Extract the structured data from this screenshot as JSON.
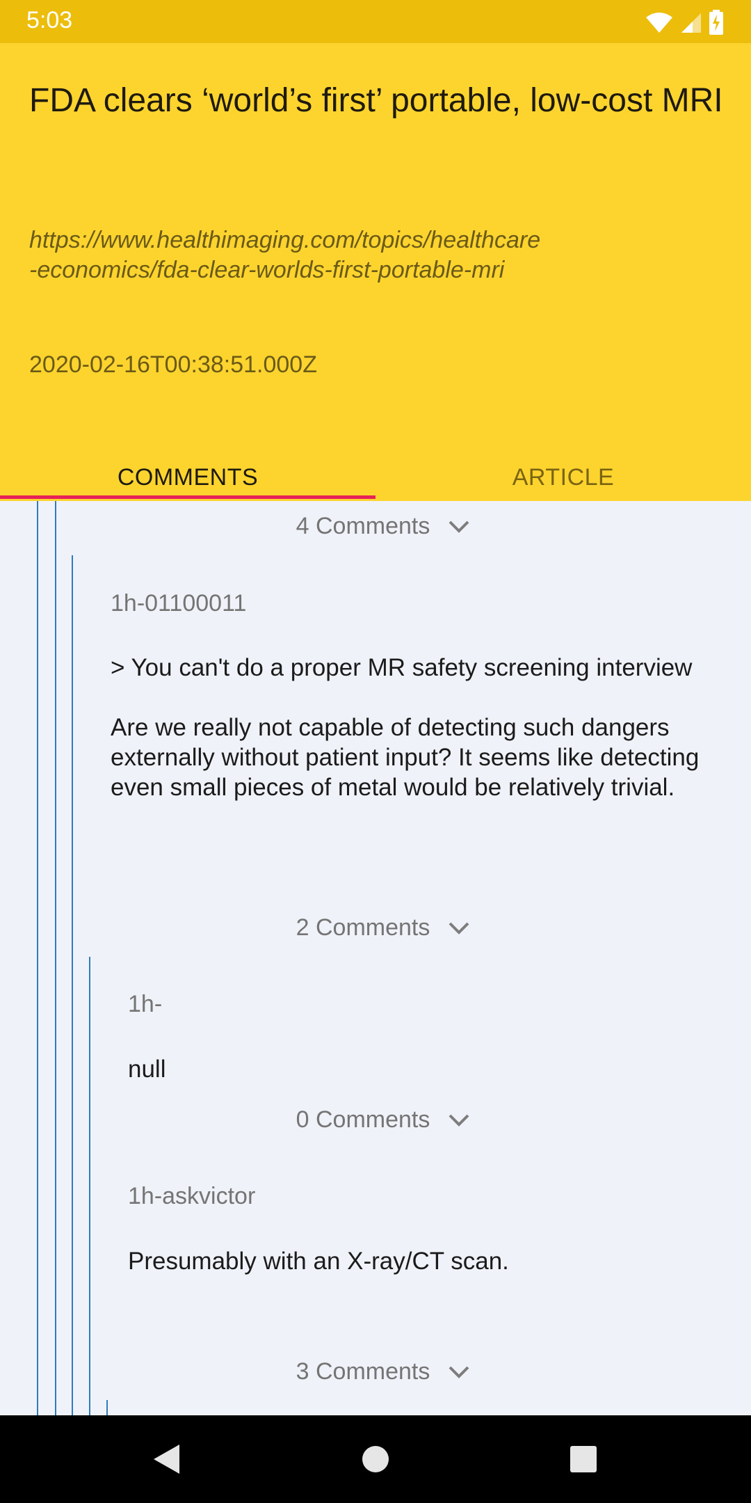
{
  "status_bar": {
    "time": "5:03"
  },
  "article": {
    "title": "FDA clears ‘world’s first’ portable, low-cost MRI",
    "url": "https://www.healthimaging.com/topics/healthcare-economics/fda-clear-worlds-first-portable-mri",
    "url_line1": "https://www.healthimaging.com/topics/healthcare",
    "url_line2": "-economics/fda-clear-worlds-first-portable-mri",
    "timestamp": "2020-02-16T00:38:51.000Z"
  },
  "tabs": [
    {
      "label": "COMMENTS",
      "selected": true
    },
    {
      "label": "ARTICLE",
      "selected": false
    }
  ],
  "colors": {
    "header": "#fdd42e",
    "status_bar": "#ecbd0b",
    "tab_indicator": "#e62158",
    "thread_line": "#2f7cb8",
    "background": "#f0f2f9"
  },
  "comments": {
    "top_count": "4 Comments",
    "items": [
      {
        "author": "1h-01100011",
        "quote": "> You can't do a proper MR safety screening interview",
        "text": "Are we really not capable of detecting such dangers externally without patient input? It seems like detecting even small pieces of metal would be relatively trivial.",
        "count": "2 Comments"
      },
      {
        "author": "1h-",
        "text": "null",
        "count": "0 Comments"
      },
      {
        "author": "1h-askvictor",
        "text": "Presumably with an X-ray/CT scan.",
        "count": "3 Comments"
      }
    ]
  },
  "icons": {
    "expand": "chevron-down-icon",
    "wifi": "wifi-icon",
    "signal": "cell-signal-icon",
    "battery": "battery-charging-icon",
    "back": "back-icon",
    "home": "home-icon",
    "recents": "recents-icon"
  }
}
